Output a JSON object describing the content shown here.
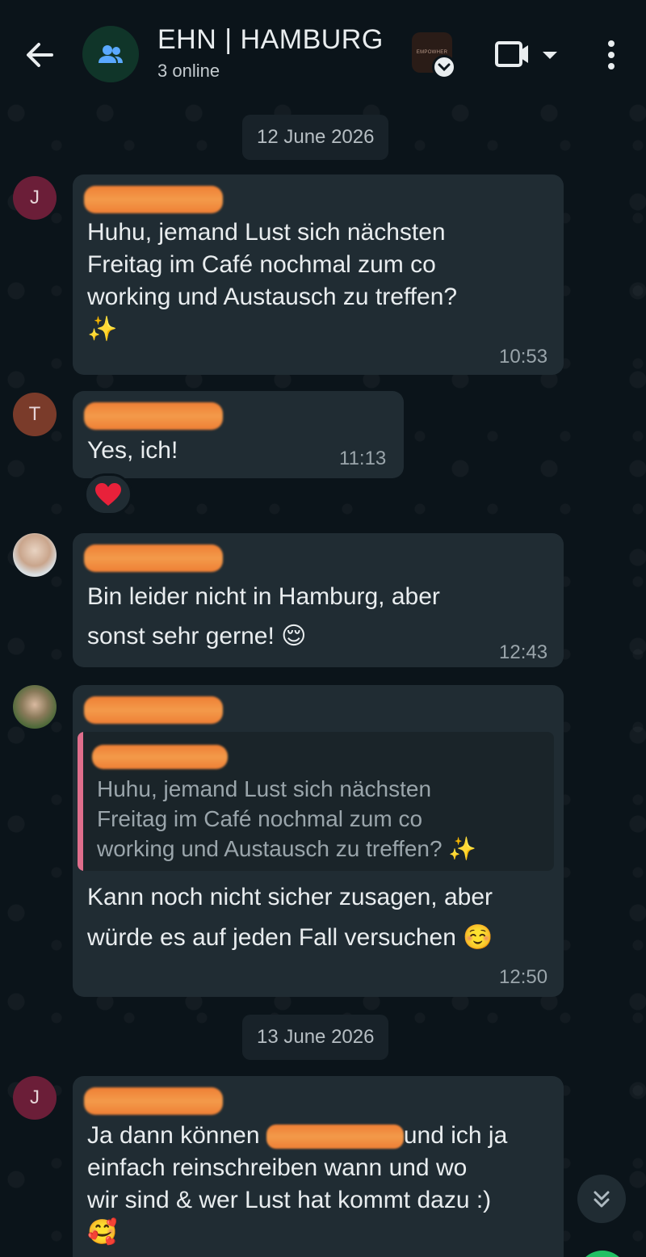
{
  "header": {
    "title": "EHN | HAMBURG",
    "status": "3 online",
    "badge_text": "EMPOWHER"
  },
  "chat": {
    "dates": [
      "12 June 2026",
      "13 June 2026"
    ],
    "messages": [
      {
        "avatar": "J",
        "text": "Huhu, jemand Lust sich nächsten\nFreitag im Café nochmal zum co\nworking und Austausch zu treffen?\n✨",
        "time": "10:53"
      },
      {
        "avatar": "T",
        "text": "Yes, ich!",
        "time": "11:13",
        "reaction": "❤️"
      },
      {
        "text": "Bin leider nicht in Hamburg, aber\nsonst sehr gerne! 😌",
        "time": "12:43"
      },
      {
        "quote": "Huhu, jemand Lust sich nächsten\nFreitag im Café nochmal zum co\nworking und Austausch zu treffen? ✨",
        "text": "Kann noch nicht sicher zusagen, aber\nwürde es auf jeden Fall versuchen ☺️",
        "time": "12:50"
      },
      {
        "avatar": "J",
        "text_before": "Ja dann können ",
        "text_after": "und ich ja",
        "text_rest": "einfach reinschreiben wann und wo\nwir sind & wer Lust hat kommt dazu :)\n🥰"
      }
    ]
  },
  "colors": {
    "background": "#0b141a",
    "bubble": "#202c33",
    "date_chip": "#182229",
    "quote_bar": "#e06e8c",
    "redaction": "#f08a3c"
  }
}
